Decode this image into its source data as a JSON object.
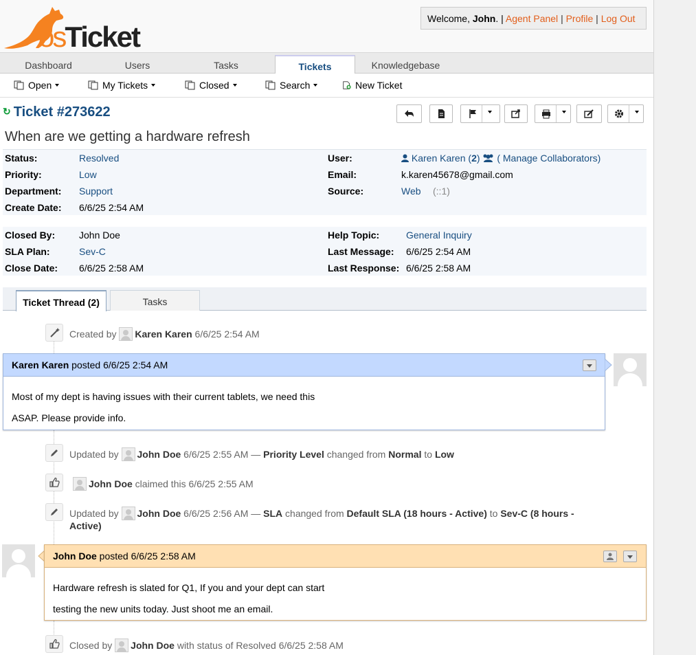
{
  "brand": {
    "logo_text_os": "os",
    "logo_text_ticket": "Ticket",
    "logo_color": "#f58220"
  },
  "welcome": {
    "prefix": "Welcome, ",
    "user": "John",
    "suffix": ". |",
    "agent_panel": "Agent Panel",
    "profile": "Profile",
    "logout": "Log Out",
    "sep": "|"
  },
  "nav": {
    "tabs": [
      "Dashboard",
      "Users",
      "Tasks",
      "Tickets",
      "Knowledgebase"
    ],
    "active": "Tickets"
  },
  "subnav": {
    "open": "Open",
    "my_tickets": "My Tickets",
    "closed": "Closed",
    "search": "Search",
    "new_ticket": "New Ticket"
  },
  "ticket": {
    "number": "Ticket #273622",
    "subject": "When are we getting a hardware refresh",
    "status_label": "Status:",
    "status": "Resolved",
    "priority_label": "Priority:",
    "priority": "Low",
    "department_label": "Department:",
    "department": "Support",
    "create_date_label": "Create Date:",
    "create_date": "6/6/25 2:54 AM",
    "user_label": "User:",
    "user": "Karen Karen",
    "user_count_open": " (",
    "user_count": "2",
    "user_count_close": ")",
    "collaborators": "( Manage Collaborators)",
    "email_label": "Email:",
    "email": "k.karen45678@gmail.com",
    "source_label": "Source:",
    "source": "Web",
    "source_ip": "(::1)",
    "closed_by_label": "Closed By:",
    "closed_by": "John Doe",
    "sla_label": "SLA Plan:",
    "sla": "Sev-C",
    "close_date_label": "Close Date:",
    "close_date": "6/6/25 2:58 AM",
    "help_topic_label": "Help Topic:",
    "help_topic": "General Inquiry",
    "last_message_label": "Last Message:",
    "last_message": "6/6/25 2:54 AM",
    "last_response_label": "Last Response:",
    "last_response": "6/6/25 2:58 AM"
  },
  "thread_tabs": {
    "thread": "Ticket Thread (2)",
    "tasks": "Tasks"
  },
  "thread": {
    "created": {
      "pre": "Created by",
      "who": "Karen Karen",
      "when": "6/6/25 2:54 AM"
    },
    "msg1": {
      "who": "Karen Karen",
      "posted": "posted",
      "when": "6/6/25 2:54 AM",
      "line1": "Most of my dept is having issues with their current tablets, we need this",
      "line2": "ASAP. Please provide info."
    },
    "upd1": {
      "pre": "Updated by",
      "who": "John Doe",
      "when": "6/6/25 2:55 AM",
      "dash": "—",
      "field": "Priority Level",
      "changed": "changed from",
      "from": "Normal",
      "to_word": "to",
      "to": "Low"
    },
    "claim": {
      "who": "John Doe",
      "text": "claimed this",
      "when": "6/6/25 2:55 AM"
    },
    "upd2": {
      "pre": "Updated by",
      "who": "John Doe",
      "when": "6/6/25 2:56 AM",
      "dash": "—",
      "field": "SLA",
      "changed": "changed from",
      "from": "Default SLA (18 hours - Active)",
      "to_word": "to",
      "to_a": "Sev-C (8 hours -",
      "to_b": "Active)"
    },
    "msg2": {
      "who": "John Doe",
      "posted": "posted",
      "when": "6/6/25 2:58 AM",
      "line1": "Hardware refresh is slated for Q1, If you and your dept can start",
      "line2": "testing the new units today. Just shoot me an email."
    },
    "closed": {
      "pre": "Closed by",
      "who": "John Doe",
      "text": "with status of Resolved",
      "when": "6/6/25 2:58 AM"
    }
  },
  "colors": {
    "link": "#184e81",
    "orange": "#e25e1b",
    "customer_header": "#c3d9ff",
    "agent_header": "#ffe0b3"
  }
}
